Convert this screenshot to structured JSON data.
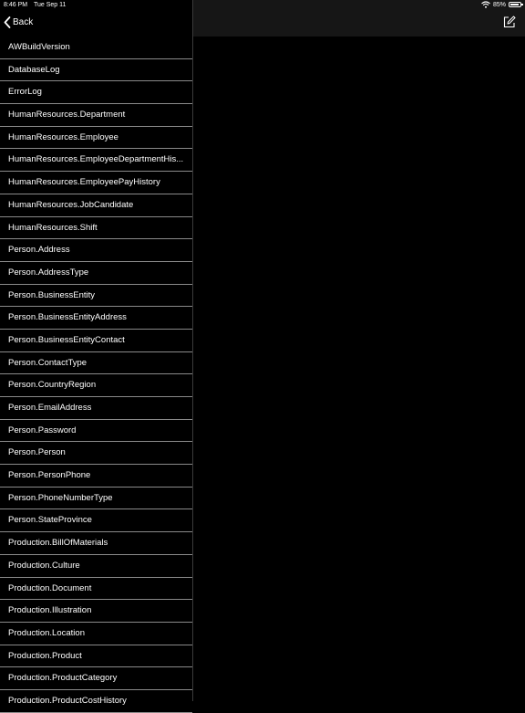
{
  "status_bar": {
    "time": "8:46 PM",
    "date": "Tue Sep 11",
    "battery": "85%",
    "battery_level": 0.85
  },
  "nav": {
    "back_label": "Back"
  },
  "tables": [
    "AWBuildVersion",
    "DatabaseLog",
    "ErrorLog",
    "HumanResources.Department",
    "HumanResources.Employee",
    "HumanResources.EmployeeDepartmentHis...",
    "HumanResources.EmployeePayHistory",
    "HumanResources.JobCandidate",
    "HumanResources.Shift",
    "Person.Address",
    "Person.AddressType",
    "Person.BusinessEntity",
    "Person.BusinessEntityAddress",
    "Person.BusinessEntityContact",
    "Person.ContactType",
    "Person.CountryRegion",
    "Person.EmailAddress",
    "Person.Password",
    "Person.Person",
    "Person.PersonPhone",
    "Person.PhoneNumberType",
    "Person.StateProvince",
    "Production.BillOfMaterials",
    "Production.Culture",
    "Production.Document",
    "Production.Illustration",
    "Production.Location",
    "Production.Product",
    "Production.ProductCategory",
    "Production.ProductCostHistory"
  ],
  "icons": {
    "back": "chevron-left-icon",
    "compose": "compose-icon",
    "wifi": "wifi-icon",
    "battery": "battery-icon"
  }
}
